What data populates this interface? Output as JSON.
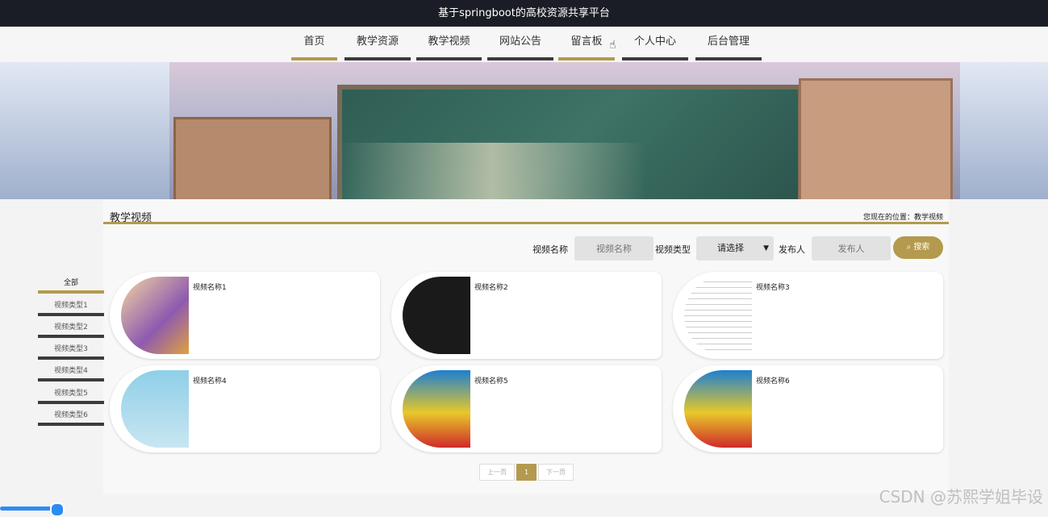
{
  "app_title": "基于springboot的高校资源共享平台",
  "nav": [
    {
      "label": "首页"
    },
    {
      "label": "教学资源"
    },
    {
      "label": "教学视频"
    },
    {
      "label": "网站公告"
    },
    {
      "label": "留言板"
    },
    {
      "label": "个人中心"
    },
    {
      "label": "后台管理"
    }
  ],
  "page_title": "教学视频",
  "breadcrumb": "您现在的位置：教学视频",
  "search": {
    "name_label": "视频名称",
    "name_placeholder": "视频名称",
    "type_label": "视频类型",
    "type_value": "请选择",
    "publisher_label": "发布人",
    "publisher_placeholder": "发布人",
    "button": "搜索"
  },
  "categories": [
    "全部",
    "视频类型1",
    "视频类型2",
    "视频类型3",
    "视频类型4",
    "视频类型5",
    "视频类型6"
  ],
  "videos": [
    "视频名称1",
    "视频名称2",
    "视频名称3",
    "视频名称4",
    "视频名称5",
    "视频名称6"
  ],
  "pagination": {
    "prev": "上一页",
    "current": "1",
    "next": "下一页"
  },
  "watermark": "CSDN @苏熙学姐毕设",
  "colors": {
    "accent": "#b49a4e",
    "topbar": "#1b1d26"
  }
}
